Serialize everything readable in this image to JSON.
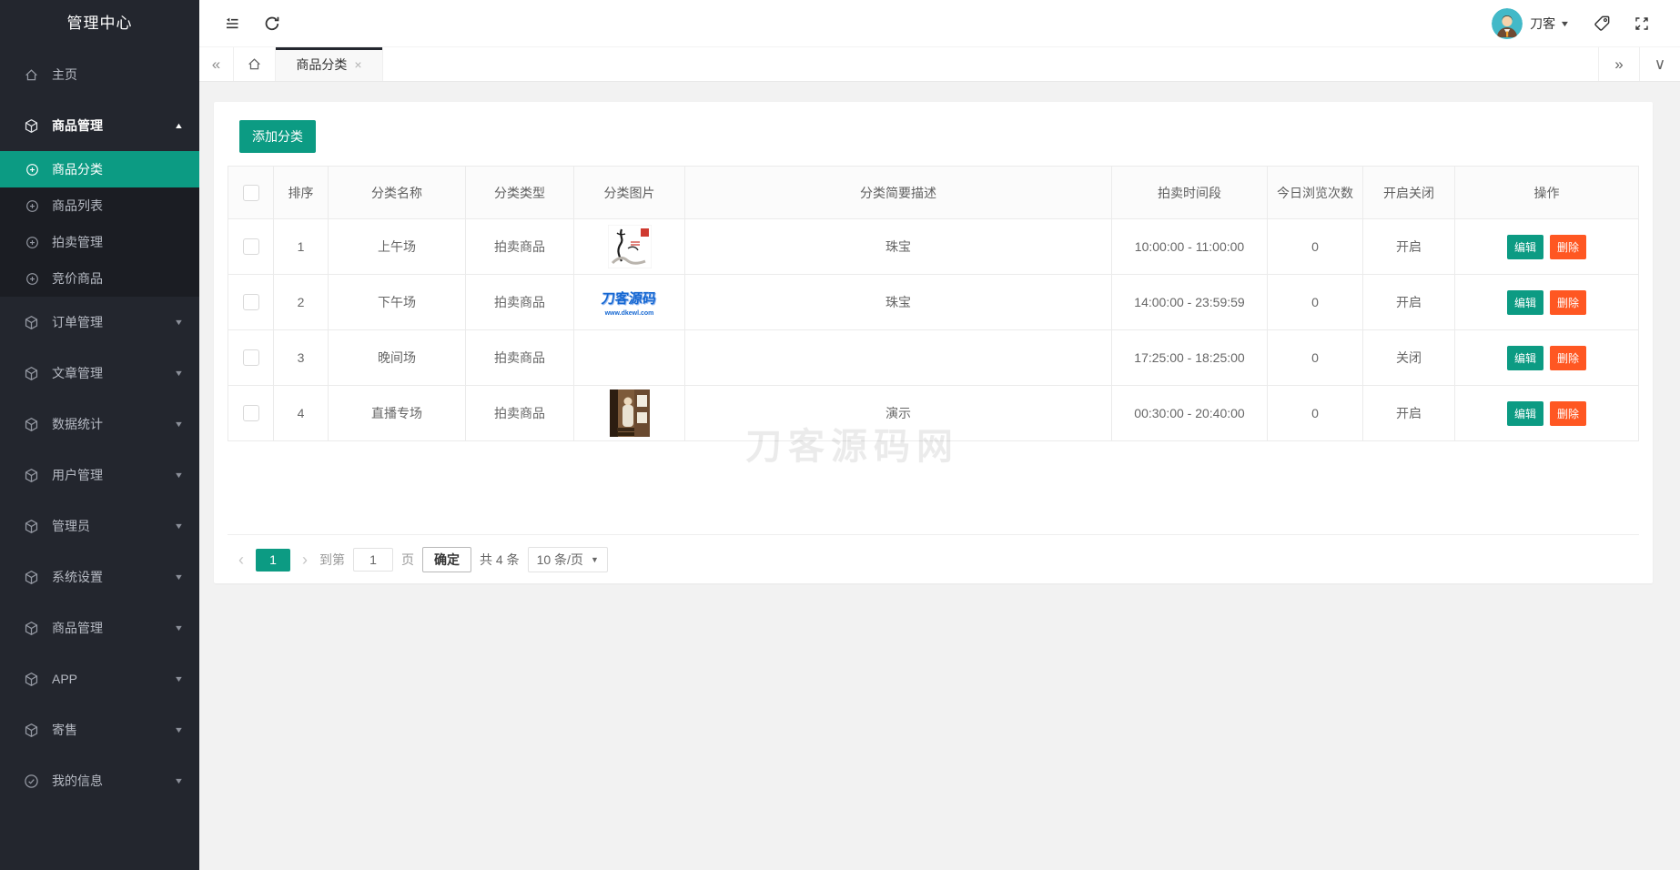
{
  "app": {
    "accent_color": "#0c9b83",
    "danger_color": "#ff5722",
    "sidebar_color": "#23262e"
  },
  "sidebar": {
    "title": "管理中心",
    "menu": [
      {
        "label": "主页"
      },
      {
        "label": "商品管理"
      },
      {
        "label": "商品分类"
      },
      {
        "label": "商品列表"
      },
      {
        "label": "拍卖管理"
      },
      {
        "label": "竞价商品"
      },
      {
        "label": "订单管理"
      },
      {
        "label": "文章管理"
      },
      {
        "label": "数据统计"
      },
      {
        "label": "用户管理"
      },
      {
        "label": "管理员"
      },
      {
        "label": "系统设置"
      },
      {
        "label": "商品管理"
      },
      {
        "label": "APP"
      },
      {
        "label": "寄售"
      },
      {
        "label": "我的信息"
      }
    ]
  },
  "topbar": {
    "user_name": "刀客"
  },
  "tabbar": {
    "active_tab": "商品分类"
  },
  "toolbar": {
    "add_button": "添加分类"
  },
  "table": {
    "headers": [
      "排序",
      "分类名称",
      "分类类型",
      "分类图片",
      "分类简要描述",
      "拍卖时间段",
      "今日浏览次数",
      "开启关闭",
      "操作"
    ],
    "edit_label": "编辑",
    "delete_label": "删除",
    "rows": [
      {
        "order": "1",
        "name": "上午场",
        "type": "拍卖商品",
        "image": "ink-painting",
        "desc": "珠宝",
        "time": "10:00:00  -  11:00:00",
        "views": "0",
        "status": "开启"
      },
      {
        "order": "2",
        "name": "下午场",
        "type": "拍卖商品",
        "image": "dk-logo",
        "logo_text": "刀客源码",
        "logo_caption": "www.dkewl.com",
        "desc": "珠宝",
        "time": "14:00:00  -  23:59:59",
        "views": "0",
        "status": "开启"
      },
      {
        "order": "3",
        "name": "晚间场",
        "type": "拍卖商品",
        "image": "",
        "desc": "",
        "time": "17:25:00  -  18:25:00",
        "views": "0",
        "status": "关闭"
      },
      {
        "order": "4",
        "name": "直播专场",
        "type": "拍卖商品",
        "image": "live-room-photo",
        "desc": "演示",
        "time": "00:30:00  -  20:40:00",
        "views": "0",
        "status": "开启"
      }
    ]
  },
  "pagination": {
    "current_page": "1",
    "goto_prefix": "到第",
    "goto_value": "1",
    "goto_suffix": "页",
    "confirm_label": "确定",
    "total_label": "共 4 条",
    "per_page_label": "10 条/页"
  },
  "watermark": "刀客源码网",
  "icons": {
    "tab_back": "«",
    "tab_forward": "»",
    "tab_menu": "∨",
    "tab_close": "×",
    "user_caret": "▼",
    "caret_up": "▲",
    "caret_down": "▼",
    "pager_prev": "‹",
    "pager_next": "›",
    "select_caret": "▼"
  }
}
